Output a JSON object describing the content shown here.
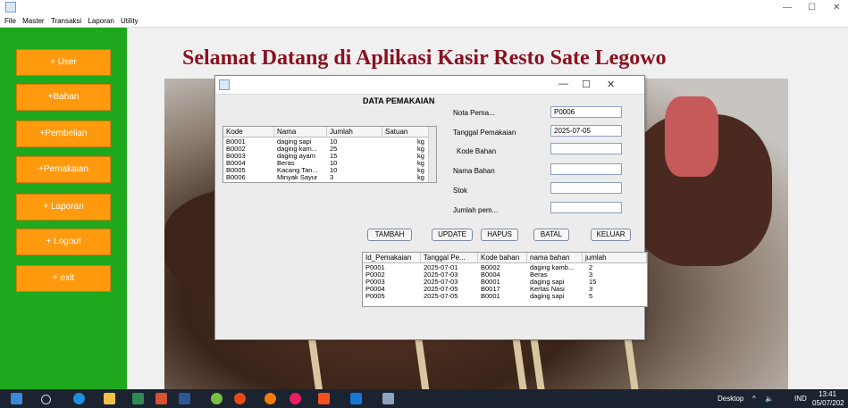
{
  "window": {
    "minimize": "—",
    "maximize": "☐",
    "close": "✕"
  },
  "menu": [
    "File",
    "Master",
    "Transaksi",
    "Laporan",
    "Utility"
  ],
  "sidebar": {
    "buttons": [
      "+ User",
      "+Bahan",
      "+Pembelian",
      "+Pemakaian",
      "+ Laporan",
      "+ Logout",
      "+ exit"
    ]
  },
  "welcome_title": "Selamat Datang di Aplikasi Kasir Resto Sate Legowo",
  "dialog": {
    "title": "DATA PEMAKAIAN",
    "minimize": "—",
    "maximize": "☐",
    "close": "✕",
    "bahan_table": {
      "columns": [
        "Kode",
        "Nama",
        "Jumlah",
        "Satuan"
      ],
      "rows": [
        [
          "B0001",
          "daging sapi",
          "10",
          "kg"
        ],
        [
          "B0002",
          "daging kam...",
          "25",
          "kg"
        ],
        [
          "B0003",
          "daging ayam",
          "15",
          "kg"
        ],
        [
          "B0004",
          "Beras",
          "10",
          "kg"
        ],
        [
          "B0005",
          "Kacang Tan...",
          "10",
          "kg"
        ],
        [
          "B0006",
          "Minyak Sayur",
          "3",
          "kg"
        ]
      ]
    },
    "form": {
      "nota_label": "Nota Pema...",
      "nota_value": "P0006",
      "tanggal_label": "Tanggal Pemakaian",
      "tanggal_value": "2025-07-05",
      "kode_label": "Kode Bahan",
      "kode_value": "",
      "nama_label": "Nama Bahan",
      "nama_value": "",
      "stok_label": "Stok",
      "stok_value": "",
      "jumlah_label": "Jumlah pem...",
      "jumlah_value": ""
    },
    "buttons": {
      "tambah": "TAMBAH",
      "update": "UPDATE",
      "hapus": "HAPUS",
      "batal": "BATAL",
      "keluar": "KELUAR"
    },
    "pemakaian_table": {
      "columns": [
        "Id_Pemakaian",
        "Tanggal Pe...",
        "Kode bahan",
        "nama bahan",
        "jumlah"
      ],
      "rows": [
        [
          "P0001",
          "2025-07-01",
          "B0002",
          "daging kamb...",
          "2"
        ],
        [
          "P0002",
          "2025-07-03",
          "B0004",
          "Beras",
          "3"
        ],
        [
          "P0003",
          "2025-07-03",
          "B0001",
          "daging sapi",
          "15"
        ],
        [
          "P0004",
          "2025-07-05",
          "B0017",
          "Kertas Nasi",
          "3"
        ],
        [
          "P0005",
          "2025-07-05",
          "B0001",
          "daging sapi",
          "5"
        ]
      ]
    }
  },
  "taskbar": {
    "desktop_label": "Desktop",
    "lang": "IND",
    "time": "13:41",
    "date": "05/07/202"
  }
}
